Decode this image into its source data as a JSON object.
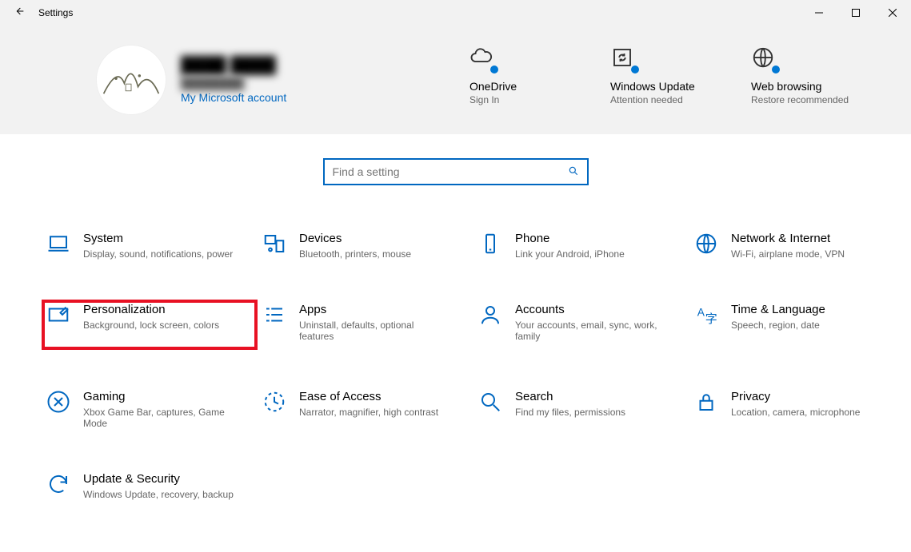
{
  "window": {
    "title": "Settings"
  },
  "profile": {
    "name": "████ ████",
    "email": "████████",
    "accountLink": "My Microsoft account"
  },
  "status": {
    "onedrive": {
      "title": "OneDrive",
      "sub": "Sign In"
    },
    "update": {
      "title": "Windows Update",
      "sub": "Attention needed"
    },
    "browse": {
      "title": "Web browsing",
      "sub": "Restore recommended"
    }
  },
  "search": {
    "placeholder": "Find a setting"
  },
  "cats": {
    "system": {
      "title": "System",
      "sub": "Display, sound, notifications, power"
    },
    "devices": {
      "title": "Devices",
      "sub": "Bluetooth, printers, mouse"
    },
    "phone": {
      "title": "Phone",
      "sub": "Link your Android, iPhone"
    },
    "network": {
      "title": "Network & Internet",
      "sub": "Wi-Fi, airplane mode, VPN"
    },
    "personal": {
      "title": "Personalization",
      "sub": "Background, lock screen, colors"
    },
    "apps": {
      "title": "Apps",
      "sub": "Uninstall, defaults, optional features"
    },
    "accounts": {
      "title": "Accounts",
      "sub": "Your accounts, email, sync, work, family"
    },
    "time": {
      "title": "Time & Language",
      "sub": "Speech, region, date"
    },
    "gaming": {
      "title": "Gaming",
      "sub": "Xbox Game Bar, captures, Game Mode"
    },
    "ease": {
      "title": "Ease of Access",
      "sub": "Narrator, magnifier, high contrast"
    },
    "searchc": {
      "title": "Search",
      "sub": "Find my files, permissions"
    },
    "privacy": {
      "title": "Privacy",
      "sub": "Location, camera, microphone"
    },
    "updatesec": {
      "title": "Update & Security",
      "sub": "Windows Update, recovery, backup"
    }
  },
  "annotations": {
    "highlighted_category": "personal"
  }
}
